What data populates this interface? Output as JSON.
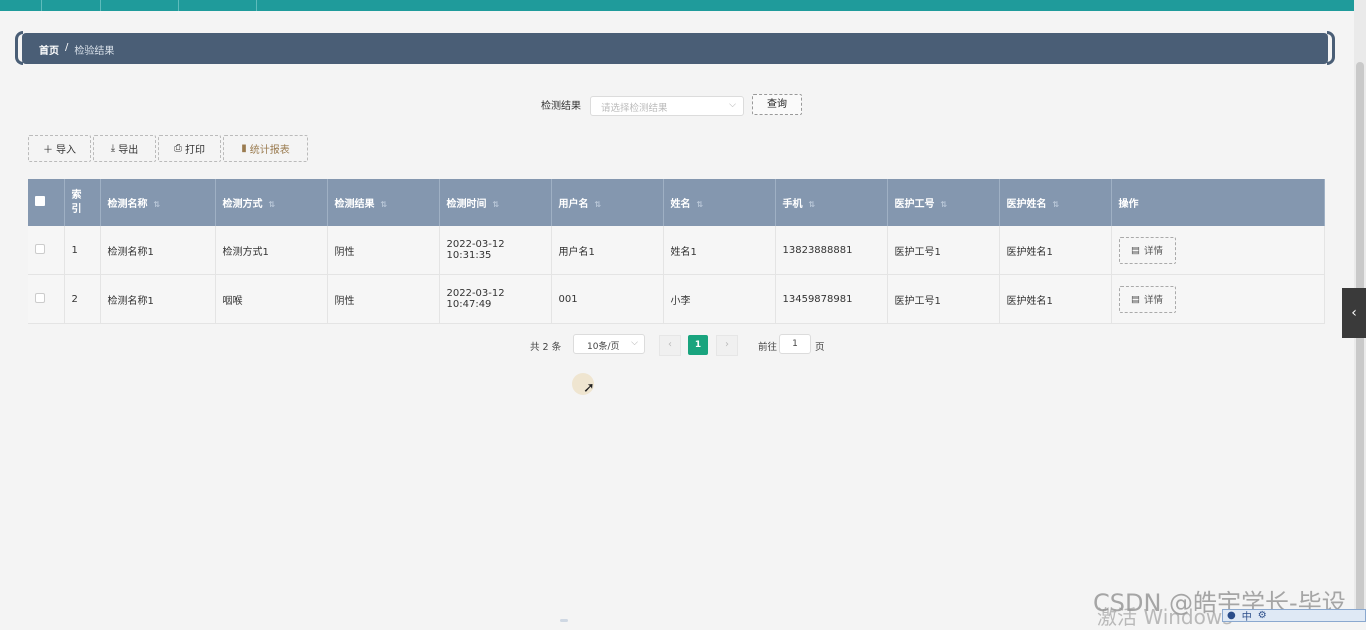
{
  "breadcrumb": {
    "home": "首页",
    "separator": "/",
    "current": "检验结果"
  },
  "filter": {
    "label": "检测结果",
    "placeholder": "请选择检测结果",
    "query_button": "查询"
  },
  "toolbar": {
    "import": "导入",
    "export": "导出",
    "print": "打印",
    "report": "统计报表",
    "import_icon": "plus-icon",
    "export_icon": "download-icon",
    "print_icon": "printer-icon",
    "report_icon": "bar-chart-icon"
  },
  "table": {
    "columns": [
      "索引",
      "检测名称",
      "检测方式",
      "检测结果",
      "检测时间",
      "用户名",
      "姓名",
      "手机",
      "医护工号",
      "医护姓名",
      "操作"
    ],
    "rows": [
      [
        "1",
        "检测名称1",
        "检测方式1",
        "阴性",
        "2022-03-12 10:31:35",
        "用户名1",
        "姓名1",
        "13823888881",
        "医护工号1",
        "医护姓名1",
        "详情"
      ],
      [
        "2",
        "检测名称1",
        "咽喉",
        "阴性",
        "2022-03-12 10:47:49",
        "001",
        "小李",
        "13459878981",
        "医护工号1",
        "医护姓名1",
        "详情"
      ]
    ]
  },
  "pagination": {
    "total_prefix": "共",
    "total": "2",
    "total_suffix": "条",
    "page_size": "10条/页",
    "current_page": "1",
    "goto_prefix": "前往",
    "goto_value": "1",
    "goto_suffix": "页"
  },
  "watermark": {
    "csdn": "CSDN @皓宇学长-毕设",
    "activate": "激活 Windows"
  },
  "colors": {
    "topbar": "#1f9b9b",
    "crumbbar": "#4a5e76",
    "table_header": "#8497af",
    "active_page": "#19a47e"
  }
}
